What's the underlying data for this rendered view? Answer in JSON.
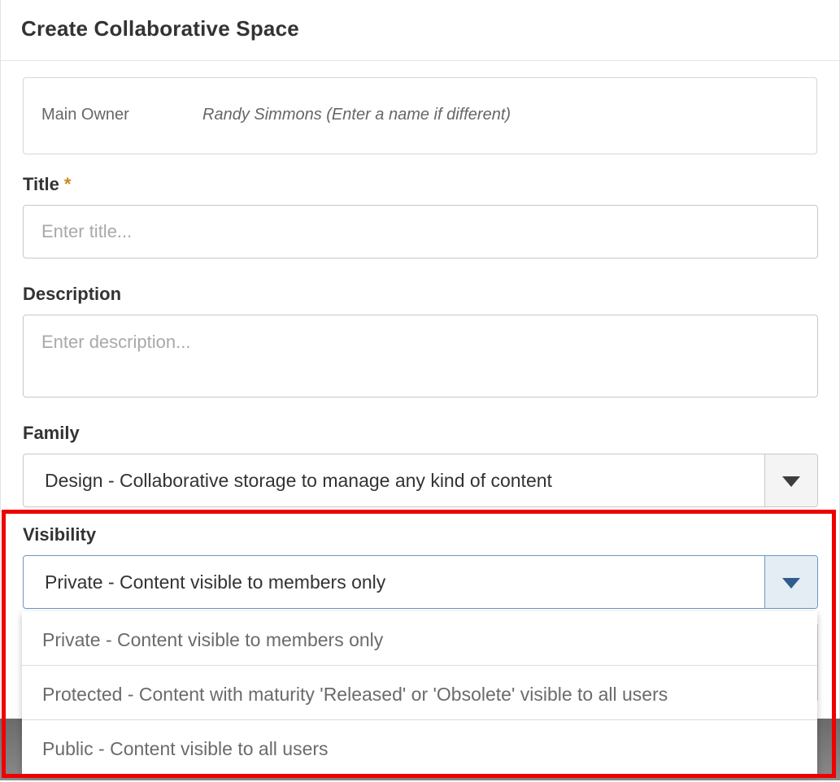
{
  "dialog": {
    "title": "Create Collaborative Space"
  },
  "owner": {
    "label": "Main Owner",
    "value": "Randy Simmons (Enter a name if different)"
  },
  "title_field": {
    "label": "Title",
    "required_mark": "*",
    "placeholder": "Enter title...",
    "value": ""
  },
  "description_field": {
    "label": "Description",
    "placeholder": "Enter description...",
    "value": ""
  },
  "family_field": {
    "label": "Family",
    "selected": "Design - Collaborative storage to manage any kind of content",
    "icon": "chevron-down-icon"
  },
  "visibility_field": {
    "label": "Visibility",
    "selected": "Private - Content visible to members only",
    "icon": "chevron-down-icon",
    "options": [
      "Private - Content visible to members only",
      "Protected - Content with maturity 'Released' or 'Obsolete' visible to all users",
      "Public - Content visible to all users"
    ]
  },
  "colors": {
    "highlight": "#ee0000",
    "required": "#c9891d",
    "focus_border": "#6d97c1"
  }
}
